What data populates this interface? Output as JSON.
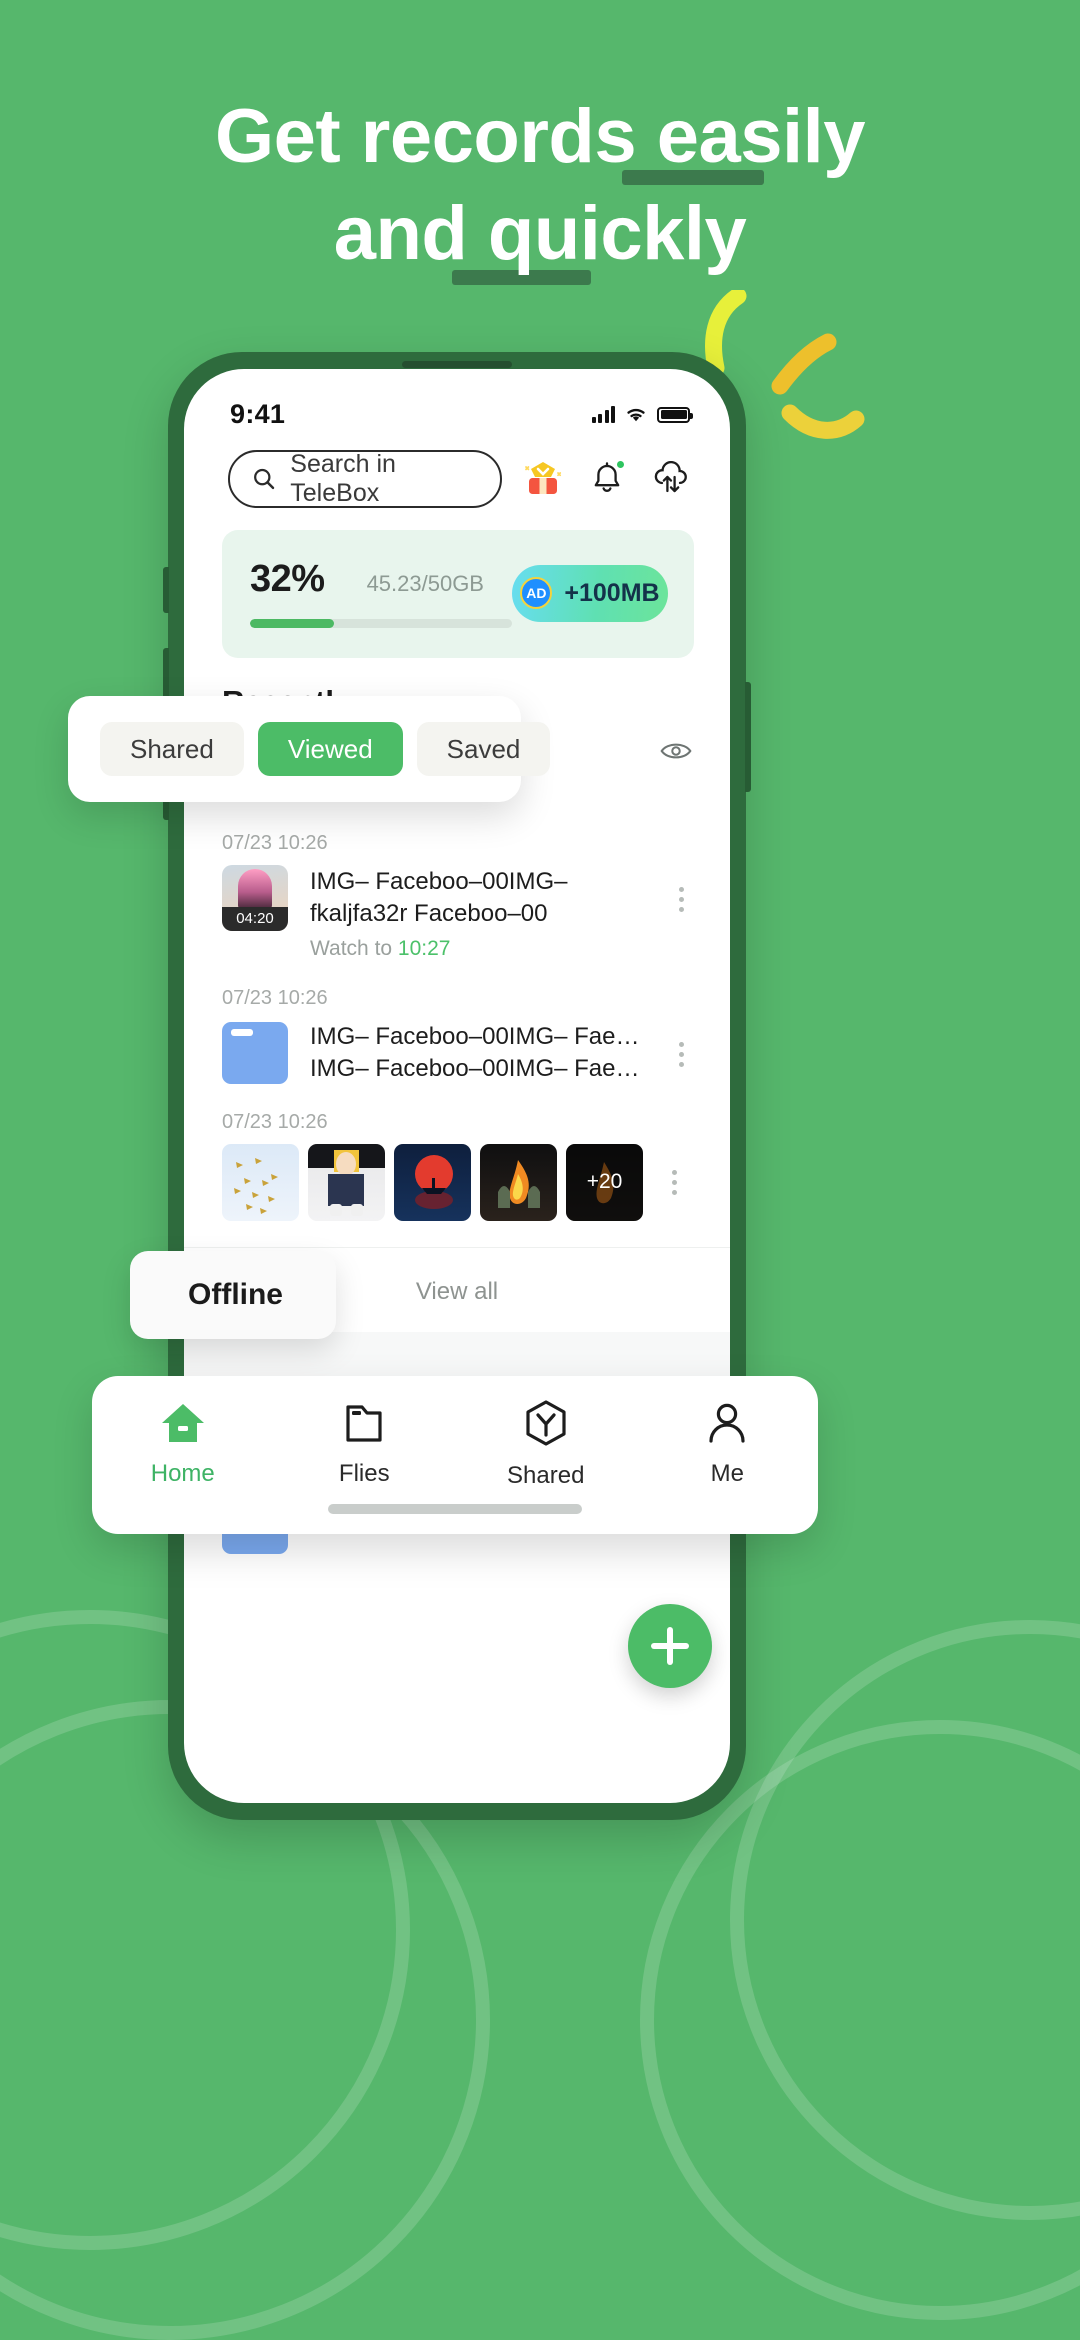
{
  "theme": {
    "brand_green": "#56b76c",
    "accent_green": "#4cbc67",
    "dark_green": "#2e6b3d",
    "dash_green": "#3c7a4d"
  },
  "headline": {
    "line1": "Get records easily",
    "line2": "and quickly"
  },
  "phone": {
    "status_bar": {
      "time": "9:41",
      "signal_icon": "cellular-signal-icon",
      "wifi_icon": "wifi-icon",
      "battery_icon": "battery-full-icon"
    },
    "search": {
      "placeholder": "Search in TeleBox",
      "search_icon": "search-icon"
    },
    "header_icons": [
      {
        "name": "gift-box-icon",
        "label": "Rewards"
      },
      {
        "name": "bell-icon",
        "label": "Notifications",
        "badge": true
      },
      {
        "name": "cloud-transfer-icon",
        "label": "Transfers"
      }
    ],
    "storage": {
      "percent_label": "32%",
      "percent_value": 32,
      "size_label": "45.23/50GB",
      "ad_badge": "AD",
      "ad_label": "+100MB"
    },
    "recently": {
      "title": "Recently",
      "tabs": [
        {
          "label": "Shared",
          "active": false
        },
        {
          "label": "Viewed",
          "active": true
        },
        {
          "label": "Saved",
          "active": false
        }
      ],
      "eye_icon": "eye-icon",
      "items": [
        {
          "date": "07/23 10:26",
          "type": "video",
          "duration": "04:20",
          "name": "IMG– Faceboo–00IMG– fkaljfa32r Faceboo–00",
          "sub_prefix": "Watch to ",
          "sub_value": "10:27",
          "menu_icon": "kebab-menu-icon"
        },
        {
          "date": "07/23 10:26",
          "type": "folder",
          "name": "IMG– Faceboo–00IMG– Fae…IMG– Faceboo–00IMG– Fae…",
          "menu_icon": "kebab-menu-icon"
        },
        {
          "date": "07/23 10:26",
          "type": "photo-grid",
          "more_label": "+20",
          "menu_icon": "kebab-menu-icon"
        }
      ],
      "view_all": "View all"
    },
    "offline": {
      "title": "Offline",
      "eye_icon": "eye-icon"
    },
    "fab": {
      "name": "add-button",
      "icon": "plus-icon"
    }
  },
  "bottom_nav": [
    {
      "label": "Home",
      "icon": "home-icon",
      "active": true
    },
    {
      "label": "Flies",
      "icon": "folder-icon",
      "active": false
    },
    {
      "label": "Shared",
      "icon": "share-hexagon-icon",
      "active": false
    },
    {
      "label": "Me",
      "icon": "person-icon",
      "active": false
    }
  ]
}
